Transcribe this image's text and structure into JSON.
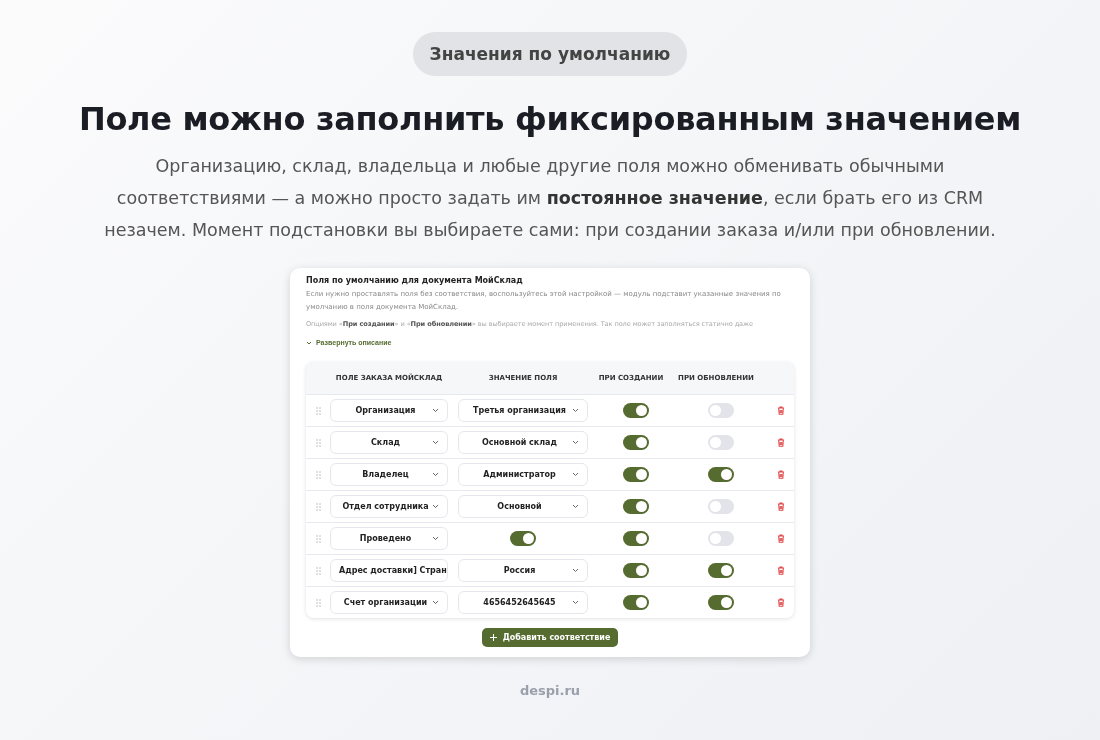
{
  "badge": "Значения по умолчанию",
  "heading": "Поле можно заполнить фиксированным значением",
  "lead": "Организацию, склад, владельца и любые другие поля можно обменивать обычными соответствиями — а можно просто задать им **постоянное значение**, если брать его из CRM незачем. Момент подстановки вы выбираете сами: при создании заказа и/или при обновлении.",
  "panel": {
    "title": "Поля по умолчанию для документа МойСклад",
    "description": "Если нужно проставлять поля без соответствия, воспользуйтесь этой настройкой — модуль подставит указанные значения по умолчанию в поля документа МойСклад.",
    "faded_text": "Опциями «**При создании**» и «**При обновлении**» вы выбираете момент применения. Так поле может заполняться статично даже",
    "expand_link": "Развернуть описание",
    "columns": [
      "ПОЛЕ ЗАКАЗА МОЙСКЛАД",
      "ЗНАЧЕНИЕ ПОЛЯ",
      "ПРИ СОЗДАНИИ",
      "ПРИ ОБНОВЛЕНИИ"
    ],
    "rows": [
      {
        "field": "Организация",
        "kind": "select",
        "value": "Третья организация",
        "on_create": true,
        "on_update": false
      },
      {
        "field": "Склад",
        "kind": "select",
        "value": "Основной склад",
        "on_create": true,
        "on_update": false
      },
      {
        "field": "Владелец",
        "kind": "select",
        "value": "Администратор",
        "on_create": true,
        "on_update": true
      },
      {
        "field": "Отдел сотрудника",
        "kind": "select",
        "value": "Основной",
        "on_create": true,
        "on_update": false
      },
      {
        "field": "Проведено",
        "kind": "toggle",
        "on": true,
        "on_create": true,
        "on_update": false
      },
      {
        "field": "Адрес доставки] Стран",
        "kind": "select",
        "value": "Россия",
        "on_create": true,
        "on_update": true
      },
      {
        "field": "Счет организации",
        "kind": "select",
        "value": "4656452645645",
        "on_create": true,
        "on_update": true
      }
    ],
    "add_button": "Добавить соответствие"
  },
  "footer": "despi.ru"
}
